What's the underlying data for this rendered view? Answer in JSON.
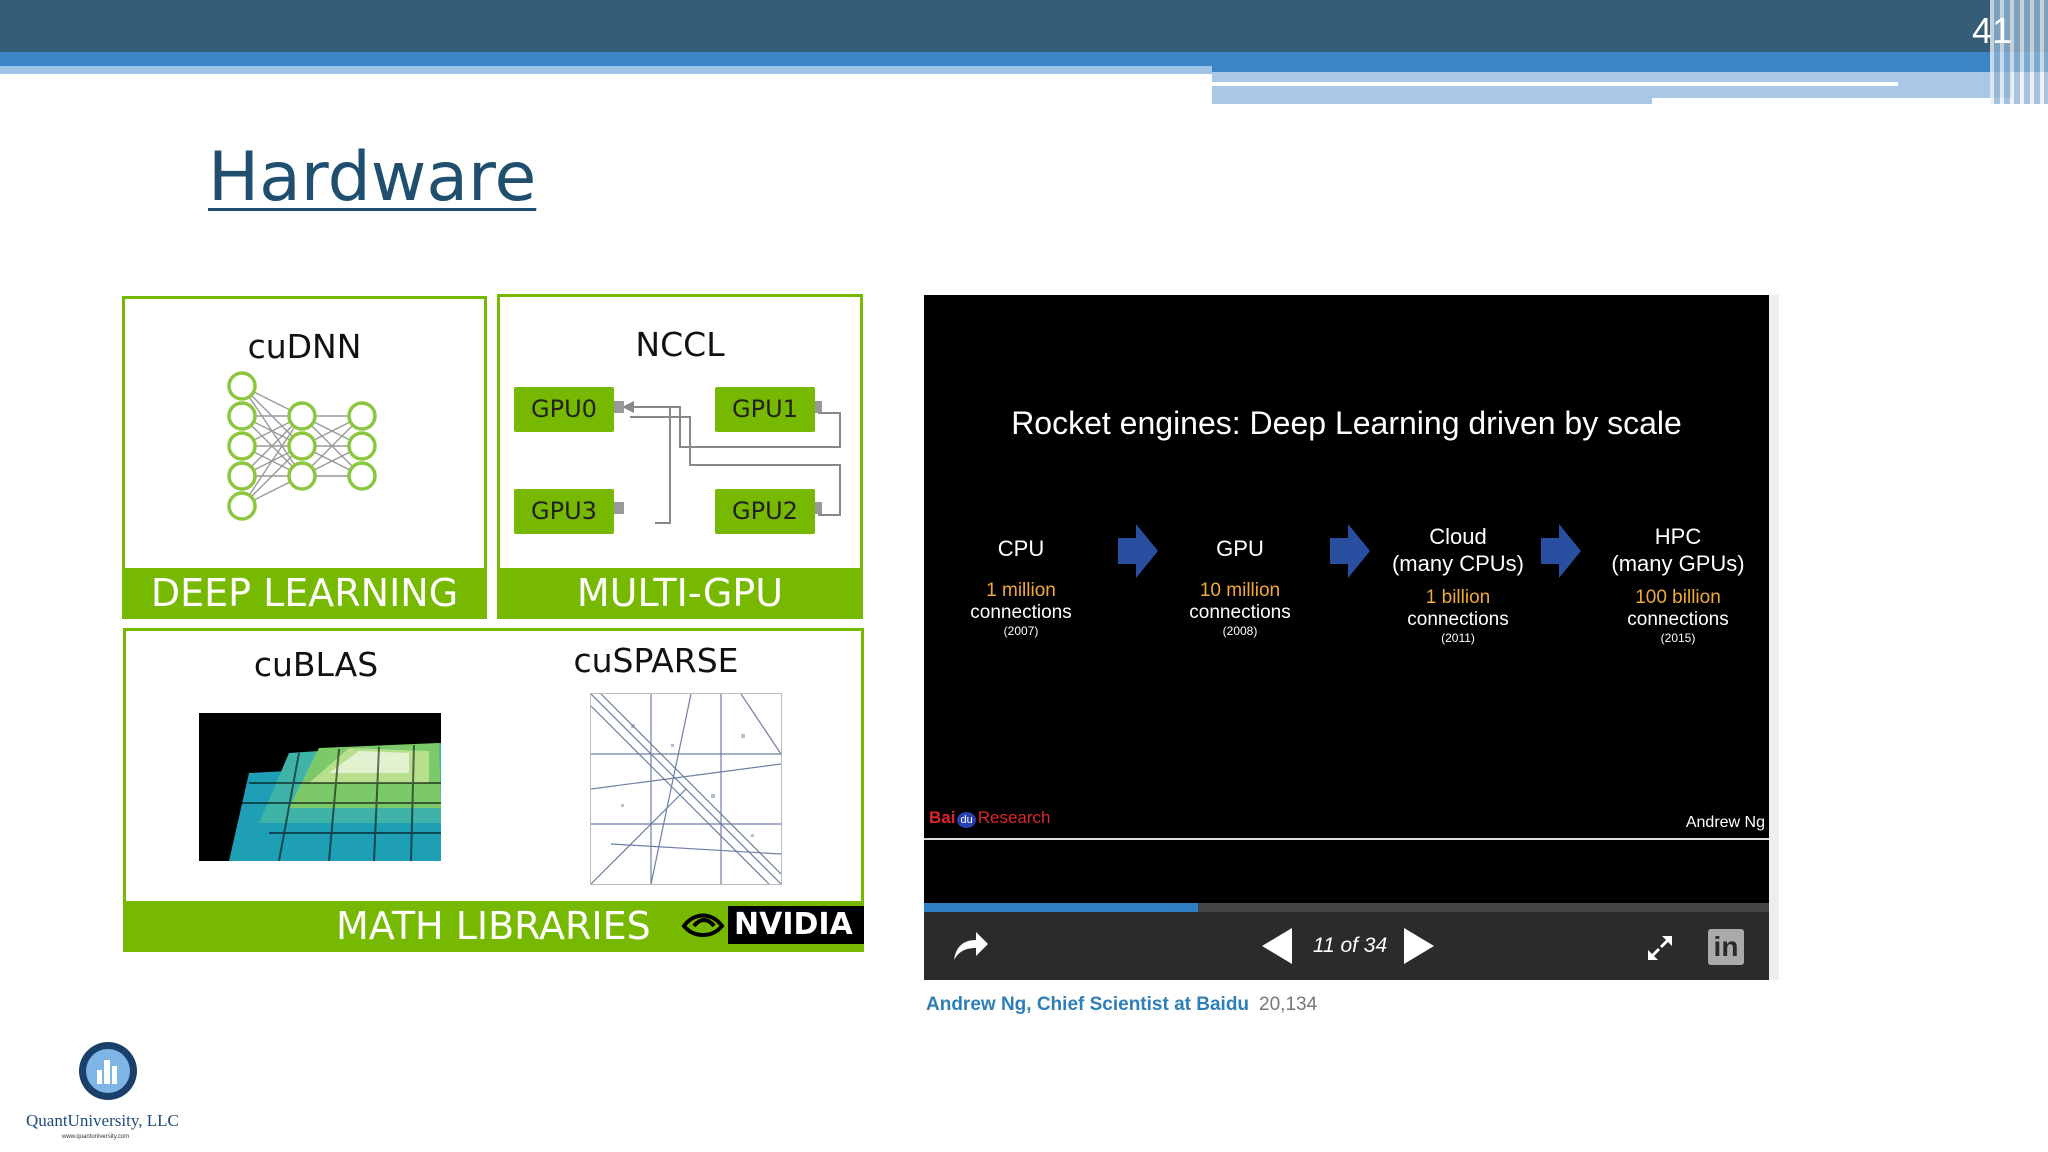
{
  "slide": {
    "number": "41",
    "title": "Hardware"
  },
  "nvidia_graphic": {
    "cudnn": {
      "title": "cuDNN",
      "banner": "DEEP LEARNING"
    },
    "nccl": {
      "title": "NCCL",
      "banner": "MULTI-GPU",
      "gpus": [
        "GPU0",
        "GPU1",
        "GPU3",
        "GPU2"
      ]
    },
    "cublas": {
      "title": "cuBLAS"
    },
    "cusparse": {
      "title": "cuSPARSE"
    },
    "math_banner": "MATH LIBRARIES",
    "brand": "NVIDIA"
  },
  "player": {
    "slide_title": "Rocket engines: Deep Learning driven by scale",
    "stages": [
      {
        "name": "CPU",
        "name2": "",
        "num": "1 million",
        "unit": "connections",
        "year": "(2007)"
      },
      {
        "name": "GPU",
        "name2": "",
        "num": "10 million",
        "unit": "connections",
        "year": "(2008)"
      },
      {
        "name": "Cloud",
        "name2": "(many CPUs)",
        "num": "1 billion",
        "unit": "connections",
        "year": "(2011)"
      },
      {
        "name": "HPC",
        "name2": "(many GPUs)",
        "num": "100 billion",
        "unit": "connections",
        "year": "(2015)"
      }
    ],
    "footer_left": {
      "bai": "Bai",
      "du": "du",
      "research": "Research"
    },
    "footer_right": "Andrew Ng",
    "progress": 0.324,
    "counter": "11 of 34",
    "linkedin": "in",
    "colors": {
      "accent": "#2f7fc4",
      "arrow": "#2b4fa0",
      "orange": "#f0a93b"
    }
  },
  "caption": {
    "link": "Andrew Ng, Chief Scientist at Baidu",
    "views": "20,134"
  },
  "footer": {
    "company": "QuantUniversity, LLC",
    "url": "www.quantuniversity.com"
  }
}
